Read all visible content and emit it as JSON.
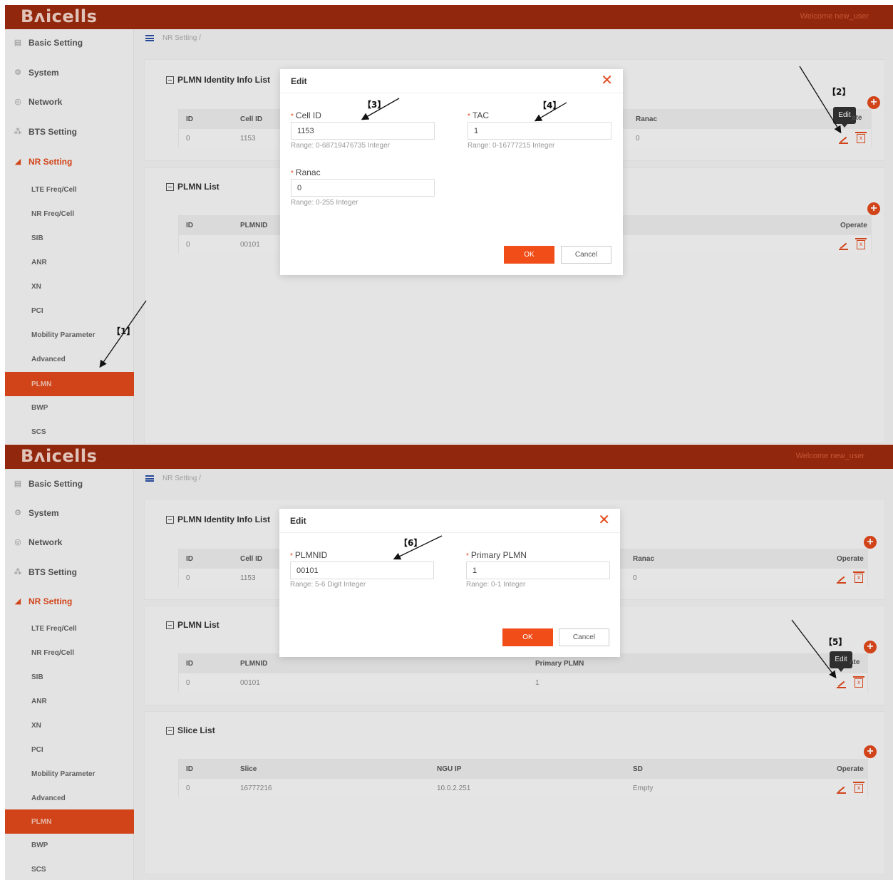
{
  "brand": {
    "logo": "Bᴧicells",
    "welcome": "Welcome new_user"
  },
  "menu": {
    "basic_setting": "Basic Setting",
    "system": "System",
    "network": "Network",
    "bts_setting": "BTS Setting",
    "nr_setting": "NR Setting",
    "sub": [
      "LTE Freq/Cell",
      "NR Freq/Cell",
      "SIB",
      "ANR",
      "XN",
      "PCI",
      "Mobility Parameter",
      "Advanced",
      "PLMN",
      "BWP",
      "SCS"
    ]
  },
  "breadcrumb": "NR Setting /",
  "sections": {
    "plmn_identity": "PLMN Identity Info List",
    "plmn_list": "PLMN List",
    "slice_list": "Slice List"
  },
  "plmn_identity_table": {
    "headers": [
      "ID",
      "Cell ID",
      "Ranac",
      "Operate"
    ],
    "row": [
      "0",
      "1153",
      "0"
    ]
  },
  "plmn_list_table": {
    "headers": [
      "ID",
      "PLMNID",
      "Primary PLMN",
      "Operate"
    ],
    "row": [
      "0",
      "00101",
      "1"
    ]
  },
  "slice_table": {
    "headers": [
      "ID",
      "Slice",
      "NGU IP",
      "SD",
      "Operate"
    ],
    "row": [
      "0",
      "16777216",
      "10.0.2.251",
      "Empty"
    ]
  },
  "tooltip_edit": "Edit",
  "modal1": {
    "title": "Edit",
    "close": "✕",
    "cell_id_label": "Cell ID",
    "cell_id_value": "1153",
    "cell_id_hint": "Range: 0-68719476735 Integer",
    "tac_label": "TAC",
    "tac_value": "1",
    "tac_hint": "Range: 0-16777215 Integer",
    "ranac_label": "Ranac",
    "ranac_value": "0",
    "ranac_hint": "Range: 0-255 Integer",
    "ok": "OK",
    "cancel": "Cancel"
  },
  "modal2": {
    "title": "Edit",
    "close": "✕",
    "plmnid_label": "PLMNID",
    "plmnid_value": "00101",
    "plmnid_hint": "Range: 5-6 Digit Integer",
    "primary_label": "Primary PLMN",
    "primary_value": "1",
    "primary_hint": "Range: 0-1 Integer",
    "ok": "OK",
    "cancel": "Cancel"
  },
  "annotations": [
    "【1】",
    "【2】",
    "【3】",
    "【4】",
    "【5】",
    "【6】"
  ],
  "colors": {
    "header": "#9c2a0e",
    "accent": "#e14a1c",
    "ok_button": "#f04d18"
  },
  "icons": [
    "menu-icon",
    "plus-circle-icon",
    "edit-icon",
    "delete-icon",
    "close-icon",
    "collapse-box-icon"
  ]
}
